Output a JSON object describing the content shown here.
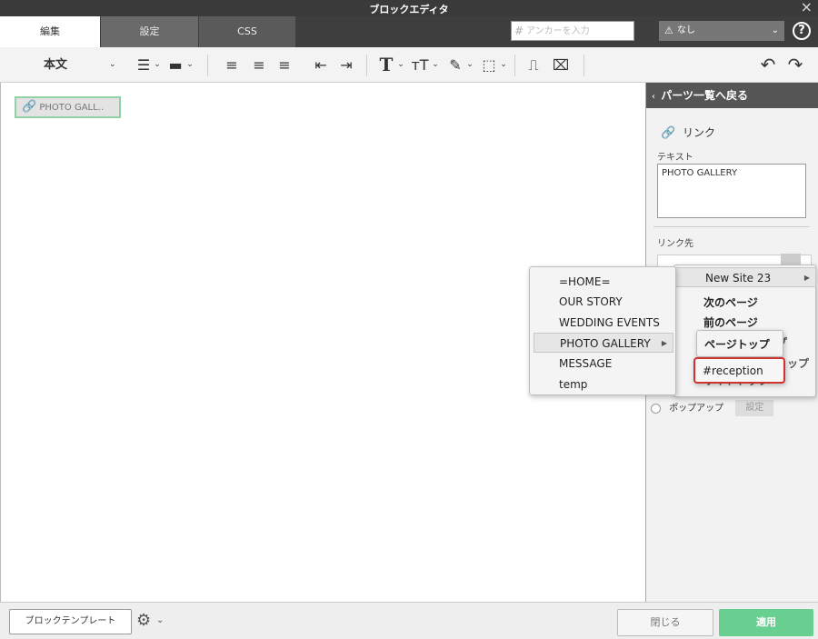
{
  "window": {
    "title": "ブロックエディタ",
    "close": "×"
  },
  "tabs": [
    {
      "label": "編集"
    },
    {
      "label": "設定"
    },
    {
      "label": "CSS"
    }
  ],
  "anchor": {
    "hash": "#",
    "placeholder": "アンカーを入力"
  },
  "class_select": {
    "icon": "⚠",
    "value": "なし",
    "caret": "⌄"
  },
  "help": "?",
  "toolbar": {
    "style": "本文",
    "caret": "⌄",
    "list_bullet": "☰",
    "list_caret": "⌄",
    "line": "▬",
    "align_left": "≡",
    "align_center": "≡",
    "align_right": "≡",
    "outdent": "⇤",
    "indent": "⇥",
    "font": "T",
    "font_size": "тT",
    "color": "✎",
    "border": "⬚",
    "insert": "⎍",
    "clear_format": "⌧",
    "undo": "↶",
    "redo": "↷"
  },
  "canvas": {
    "link_icon": "🔗",
    "link_text": "PHOTO GALL.."
  },
  "panel": {
    "back_chevron": "‹",
    "back_label": "パーツ一覧へ戻る",
    "link_icon": "🔗",
    "title": "リンク",
    "text_label": "テキスト",
    "text_value": "PHOTO GALLERY",
    "target_label": "リンク先",
    "popup_label": "ポップアップ",
    "popup_setting": "設定"
  },
  "menu_pages": {
    "items": [
      "=HOME=",
      "OUR STORY",
      "WEDDING EVENTS",
      "PHOTO GALLERY",
      "MESSAGE",
      "temp"
    ],
    "arrow": "▶"
  },
  "menu_site": {
    "site": "New Site 23",
    "arrow": "▶",
    "next": "次のページ",
    "prev": "前のページ",
    "hidden_a": "プ",
    "hidden_b": "ップ",
    "site_top": "サイトトップ"
  },
  "menu_anchor_top": {
    "label": "ページトップ"
  },
  "menu_anchor": {
    "label": "#reception"
  },
  "footer": {
    "template": "ブロックテンプレート",
    "gear": "⚙",
    "gear_caret": "⌄",
    "close": "閉じる",
    "apply": "適用"
  }
}
